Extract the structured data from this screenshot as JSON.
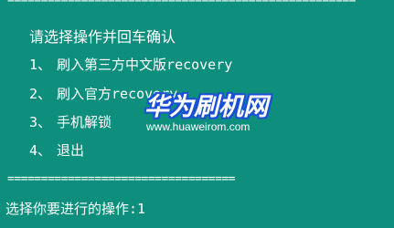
{
  "console": {
    "separator_top": "====================================================",
    "separator_bottom": "==================================",
    "prompt_title": "请选择操作并回车确认",
    "menu": [
      {
        "num": "1、",
        "label": "刷入第三方中文版recovery"
      },
      {
        "num": "2、",
        "label": "刷入官方recovery"
      },
      {
        "num": "3、",
        "label": "手机解锁"
      },
      {
        "num": "4、",
        "label": "退出"
      }
    ],
    "input_prompt": "选择你要进行的操作:1"
  },
  "watermark": {
    "title": "华为刷机网",
    "url": "www.huaweirom.com"
  },
  "colors": {
    "background": "#0e8f7e",
    "text": "#ffffff",
    "watermark_outline": "#1a4fd6"
  }
}
